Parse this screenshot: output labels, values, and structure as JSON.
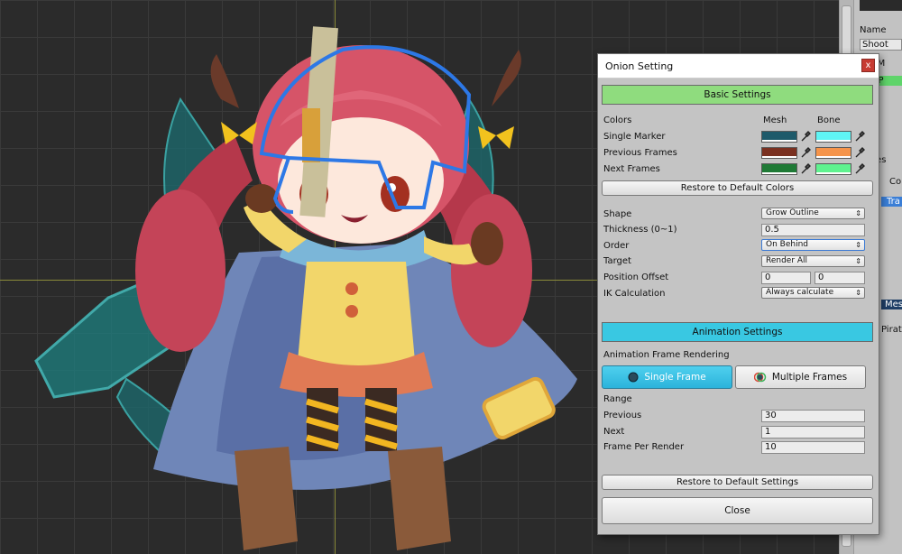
{
  "side_panel": {
    "items": [
      "Name",
      "Shoot",
      "get M",
      "P",
      "elines",
      "Co",
      "Tra",
      "Mes",
      "Pirat"
    ]
  },
  "dialog": {
    "title": "Onion Setting",
    "close_glyph": "x",
    "basic_settings": {
      "header": "Basic Settings",
      "colors_label": "Colors",
      "mesh_col": "Mesh",
      "bone_col": "Bone",
      "rows": [
        {
          "label": "Single Marker",
          "mesh_color": "#1e5a6a",
          "bone_color": "#5ff4f4"
        },
        {
          "label": "Previous Frames",
          "mesh_color": "#7a3020",
          "bone_color": "#f6944a"
        },
        {
          "label": "Next Frames",
          "mesh_color": "#1f7a36",
          "bone_color": "#5ff28f"
        }
      ],
      "restore_colors": "Restore to Default Colors",
      "shape_label": "Shape",
      "shape_value": "Grow Outline",
      "thickness_label": "Thickness (0~1)",
      "thickness_value": "0.5",
      "order_label": "Order",
      "order_value": "On Behind",
      "target_label": "Target",
      "target_value": "Render All",
      "position_offset_label": "Position Offset",
      "position_offset_x": "0",
      "position_offset_y": "0",
      "ik_label": "IK Calculation",
      "ik_value": "Always calculate"
    },
    "animation_settings": {
      "header": "Animation Settings",
      "frame_rendering_label": "Animation Frame Rendering",
      "single_frame": "Single Frame",
      "multiple_frames": "Multiple Frames",
      "range_label": "Range",
      "previous_label": "Previous",
      "previous_value": "30",
      "next_label": "Next",
      "next_value": "1",
      "fpr_label": "Frame Per Render",
      "fpr_value": "10"
    },
    "restore_settings": "Restore to Default Settings",
    "close": "Close"
  }
}
